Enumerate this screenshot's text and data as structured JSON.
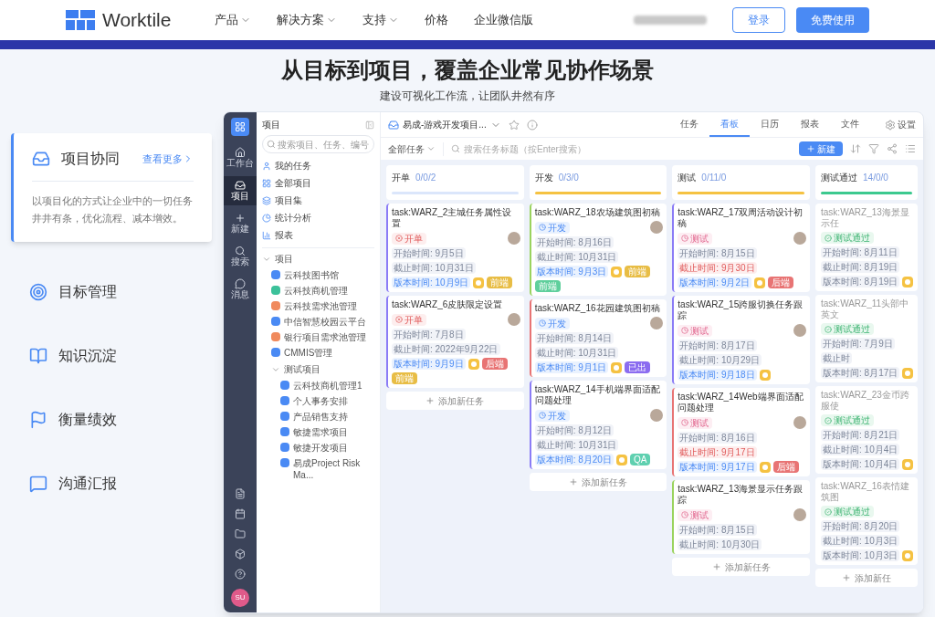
{
  "header": {
    "logo": "Worktile",
    "nav": [
      {
        "label": "产品",
        "dropdown": true
      },
      {
        "label": "解决方案",
        "dropdown": true
      },
      {
        "label": "支持",
        "dropdown": true
      },
      {
        "label": "价格",
        "dropdown": false
      },
      {
        "label": "企业微信版",
        "dropdown": false
      }
    ],
    "login": "登录",
    "signup": "免费使用"
  },
  "hero": {
    "title": "从目标到项目，覆盖企业常见协作场景",
    "subtitle": "建设可视化工作流，让团队井然有序"
  },
  "features": [
    {
      "label": "项目协同",
      "selected": true,
      "more": "查看更多",
      "description": "以项目化的方式让企业中的一切任务井井有条，优化流程、减本增效。"
    },
    {
      "label": "目标管理",
      "selected": false
    },
    {
      "label": "知识沉淀",
      "selected": false
    },
    {
      "label": "衡量绩效",
      "selected": false
    },
    {
      "label": "沟通汇报",
      "selected": false
    }
  ],
  "app": {
    "rail": [
      {
        "label": "工作台",
        "selected": false
      },
      {
        "label": "项目",
        "selected": true
      },
      {
        "label": "新建",
        "selected": false
      },
      {
        "label": "搜索",
        "selected": false
      },
      {
        "label": "消息",
        "selected": false
      }
    ],
    "user": "SU",
    "sidebar": {
      "title": "项目",
      "search_placeholder": "搜索项目、任务、编号",
      "nav": [
        "我的任务",
        "全部项目",
        "项目集",
        "统计分析",
        "报表"
      ],
      "tree": [
        {
          "label": "项目",
          "expanded": true,
          "children": [
            {
              "label": "云科技图书馆",
              "color": "#4a8af4"
            },
            {
              "label": "云科技商机管理",
              "color": "#3cc19a"
            },
            {
              "label": "云科技需求池管理",
              "color": "#f08a5d"
            },
            {
              "label": "中信智慧校园云平台",
              "color": "#4a8af4"
            },
            {
              "label": "银行项目需求池管理",
              "color": "#f08a5d"
            },
            {
              "label": "CMMIS管理",
              "color": "#4a8af4"
            },
            {
              "label": "测试项目",
              "expanded": true,
              "children": [
                {
                  "label": "云科技商机管理1",
                  "color": "#4a8af4"
                },
                {
                  "label": "个人事务安排",
                  "color": "#4a8af4"
                },
                {
                  "label": "产品销售支持",
                  "color": "#4a8af4"
                },
                {
                  "label": "敏捷需求项目",
                  "color": "#4a8af4"
                },
                {
                  "label": "敏捷开发项目",
                  "color": "#4a8af4"
                },
                {
                  "label": "易成Project Risk Ma...",
                  "color": "#4a8af4"
                }
              ]
            }
          ]
        }
      ]
    },
    "project_title": "易成-游戏开发项目...",
    "tabs": [
      {
        "label": "任务",
        "selected": false
      },
      {
        "label": "看板",
        "selected": true
      },
      {
        "label": "日历",
        "selected": false
      },
      {
        "label": "报表",
        "selected": false
      },
      {
        "label": "文件",
        "selected": false
      }
    ],
    "settings": "设置",
    "filter": "全部任务",
    "search_placeholder": "搜索任务标题（按Enter搜索）",
    "new_button": "新建",
    "columns": [
      {
        "title": "开单",
        "count": "0/0/2",
        "color": "#dbe6fb",
        "faded": false,
        "add_task": "添加新任务",
        "cards": [
          {
            "title": "task:WARZ_2主城任务属性设置",
            "color": "#8b7cf6",
            "status": {
              "kind": "open",
              "label": "开单"
            },
            "chips": [
              {
                "kind": "date",
                "text": "开始时间: 9月5日"
              },
              {
                "kind": "date",
                "text": "截止时间: 10月31日"
              },
              {
                "kind": "version",
                "text": "版本时间: 10月9日"
              }
            ],
            "badge": true,
            "tags": [
              {
                "text": "前端",
                "color": "#e8bd45"
              }
            ]
          },
          {
            "title": "task:WARZ_6皮肤限定设置",
            "color": "#8b7cf6",
            "status": {
              "kind": "open",
              "label": "开单"
            },
            "chips": [
              {
                "kind": "date",
                "text": "开始时间: 7月8日"
              },
              {
                "kind": "date",
                "text": "截止时间: 2022年9月22日"
              },
              {
                "kind": "version",
                "text": "版本时间: 9月9日"
              }
            ],
            "badge": true,
            "tags": [
              {
                "text": "后端",
                "color": "#e87474"
              },
              {
                "text": "前端",
                "color": "#e8bd45"
              }
            ]
          }
        ]
      },
      {
        "title": "开发",
        "count": "0/3/0",
        "color": "#f5c242",
        "faded": false,
        "add_task": "添加新任务",
        "cards": [
          {
            "title": "task:WARZ_18农场建筑图初稿",
            "color": "#9ad35e",
            "status": {
              "kind": "dev",
              "label": "开发"
            },
            "chips": [
              {
                "kind": "date",
                "text": "开始时间: 8月16日"
              },
              {
                "kind": "date",
                "text": "截止时间: 10月31日"
              },
              {
                "kind": "version",
                "text": "版本时间: 9月3日"
              }
            ],
            "badge": true,
            "tags": [
              {
                "text": "前端",
                "color": "#e8bd45"
              },
              {
                "text": "前端",
                "color": "#5fcf9c"
              }
            ]
          },
          {
            "title": "task:WARZ_16花园建筑图初稿",
            "color": "#e87474",
            "status": {
              "kind": "dev",
              "label": "开发"
            },
            "chips": [
              {
                "kind": "date",
                "text": "开始时间: 8月14日"
              },
              {
                "kind": "date",
                "text": "截止时间: 10月31日"
              },
              {
                "kind": "version",
                "text": "版本时间: 9月1日"
              }
            ],
            "badge": true,
            "tags": [
              {
                "text": "已出",
                "color": "#8b6cf0"
              }
            ]
          },
          {
            "title": "task:WARZ_14手机端界面适配问题处理",
            "color": "#8b7cf6",
            "status": {
              "kind": "dev",
              "label": "开发"
            },
            "chips": [
              {
                "kind": "date",
                "text": "开始时间: 8月12日"
              },
              {
                "kind": "date",
                "text": "截止时间: 10月31日"
              },
              {
                "kind": "version",
                "text": "版本时间: 8月20日"
              }
            ],
            "badge": true,
            "tags": [
              {
                "text": "QA",
                "color": "#5fd0b0"
              }
            ]
          }
        ]
      },
      {
        "title": "测试",
        "count": "0/11/0",
        "color": "#f5c242",
        "faded": false,
        "add_task": "添加新任务",
        "cards": [
          {
            "title": "task:WARZ_17双周活动设计初稿",
            "color": "#8b7cf6",
            "status": {
              "kind": "test",
              "label": "测试"
            },
            "chips": [
              {
                "kind": "date",
                "text": "开始时间: 8月15日"
              },
              {
                "kind": "overdue",
                "text": "截止时间: 9月30日"
              },
              {
                "kind": "version",
                "text": "版本时间: 9月2日"
              }
            ],
            "badge": true,
            "tags": [
              {
                "text": "后端",
                "color": "#e87474"
              }
            ]
          },
          {
            "title": "task:WARZ_15跨服切换任务跟踪",
            "color": "#8b7cf6",
            "status": {
              "kind": "test",
              "label": "测试"
            },
            "chips": [
              {
                "kind": "date",
                "text": "开始时间: 8月17日"
              },
              {
                "kind": "date",
                "text": "截止时间: 10月29日"
              },
              {
                "kind": "version",
                "text": "版本时间: 9月18日"
              }
            ],
            "badge": true
          },
          {
            "title": "task:WARZ_14Web端界面适配问题处理",
            "color": "#e87474",
            "status": {
              "kind": "test",
              "label": "测试"
            },
            "chips": [
              {
                "kind": "date",
                "text": "开始时间: 8月16日"
              },
              {
                "kind": "overdue",
                "text": "截止时间: 9月17日"
              },
              {
                "kind": "version",
                "text": "版本时间: 9月17日"
              }
            ],
            "badge": true,
            "tags": [
              {
                "text": "后端",
                "color": "#e87474"
              }
            ]
          },
          {
            "title": "task:WARZ_13海景显示任务跟踪",
            "color": "#9ad35e",
            "status": {
              "kind": "test",
              "label": "测试"
            },
            "chips": [
              {
                "kind": "date",
                "text": "开始时间: 8月15日"
              },
              {
                "kind": "date",
                "text": "截止时间: 10月30日"
              }
            ],
            "badge": false
          }
        ]
      },
      {
        "title": "测试通过",
        "count": "14/0/0",
        "color": "#3cc98f",
        "faded": true,
        "add_task": "添加新任",
        "cards": [
          {
            "title": "task:WARZ_13海景显示任",
            "status": {
              "kind": "passed",
              "label": "测试通过"
            },
            "chips": [
              {
                "kind": "date",
                "text": "开始时间: 8月11日"
              },
              {
                "kind": "date",
                "text": "截止时间: 8月19日"
              },
              {
                "kind": "date",
                "text": "版本时间: 8月19日"
              }
            ],
            "badge": true
          },
          {
            "title": "task:WARZ_11头部中英文",
            "status": {
              "kind": "passed",
              "label": "测试通过"
            },
            "chips": [
              {
                "kind": "date",
                "text": "开始时间: 7月9日"
              },
              {
                "kind": "date",
                "text": "截止时"
              },
              {
                "kind": "date",
                "text": "版本时间: 8月17日"
              }
            ],
            "badge": true
          },
          {
            "title": "task:WARZ_23金币跨服使",
            "status": {
              "kind": "passed",
              "label": "测试通过"
            },
            "chips": [
              {
                "kind": "date",
                "text": "开始时间: 8月21日"
              },
              {
                "kind": "date",
                "text": "截止时间: 10月4日"
              },
              {
                "kind": "date",
                "text": "版本时间: 10月4日"
              }
            ],
            "badge": true
          },
          {
            "title": "task:WARZ_16表情建筑图",
            "status": {
              "kind": "passed",
              "label": "测试通过"
            },
            "chips": [
              {
                "kind": "date",
                "text": "开始时间: 8月20日"
              },
              {
                "kind": "date",
                "text": "截止时间: 10月3日"
              },
              {
                "kind": "date",
                "text": "版本时间: 10月3日"
              }
            ],
            "badge": true
          }
        ]
      }
    ]
  }
}
